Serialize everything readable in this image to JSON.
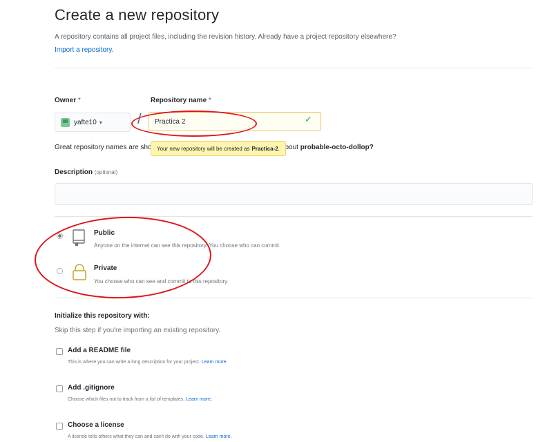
{
  "header": {
    "title": "Create a new repository",
    "subtitle": "A repository contains all project files, including the revision history. Already have a project repository elsewhere?",
    "import_link": "Import a repository."
  },
  "form": {
    "owner_label": "Owner",
    "owner_required": "*",
    "owner_value": "yafte10",
    "owner_caret": "▾",
    "slash": "/",
    "repo_name_label": "Repository name",
    "repo_name_required": "*",
    "repo_name_value": "Practica 2",
    "suggestion_text": "Great repository names are short and memorable. Need inspiration? How about",
    "suggestion_name": "probable-octo-dollop?",
    "tooltip_text": "Your new repository will be created as",
    "tooltip_name": "Practica-2",
    "description_label": "Description",
    "description_optional": "(optional)",
    "description_value": ""
  },
  "visibility": {
    "public_title": "Public",
    "public_desc": "Anyone on the internet can see this repository. You choose who can commit.",
    "private_title": "Private",
    "private_desc": "You choose who can see and commit to this repository.",
    "selected": "Public"
  },
  "init": {
    "title": "Initialize this repository with:",
    "desc": "Skip this step if you're importing an existing repository.",
    "options": [
      {
        "title": "Add a README file",
        "desc": "This is where you can write a long description for your project.",
        "link": "Learn more."
      },
      {
        "title": "Add .gitignore",
        "desc": "Choose which files not to track from a list of templates.",
        "link": "Learn more."
      },
      {
        "title": "Choose a license",
        "desc": "A license tells others what they can and can't do with your code.",
        "link": "Learn more."
      }
    ]
  },
  "icons": {
    "check": "✓",
    "public": "repo-icon",
    "private": "lock-icon"
  },
  "colors": {
    "link": "#0366d6",
    "annotation": "#e0161a",
    "tooltip_bg": "#fff5b1",
    "success": "#28a745"
  }
}
